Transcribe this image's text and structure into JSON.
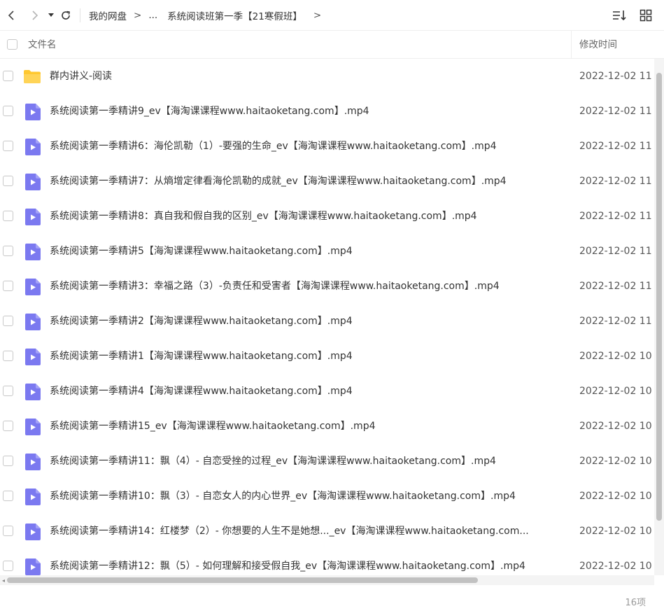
{
  "nav": {
    "breadcrumbs": [
      "我的网盘",
      "...",
      "系统阅读班第一季【21寒假班】"
    ],
    "separator": ">",
    "trailing_separator": ">"
  },
  "columns": {
    "name": "文件名",
    "time": "修改时间"
  },
  "files": [
    {
      "type": "folder",
      "name": "群内讲义-阅读",
      "time": "2022-12-02 11"
    },
    {
      "type": "video",
      "name": "系统阅读第一季精讲9_ev【海淘课课程www.haitaoketang.com】.mp4",
      "time": "2022-12-02 11"
    },
    {
      "type": "video",
      "name": "系统阅读第一季精讲6：海伦凯勒（1）-要强的生命_ev【海淘课课程www.haitaoketang.com】.mp4",
      "time": "2022-12-02 11"
    },
    {
      "type": "video",
      "name": "系统阅读第一季精讲7：从熵增定律看海伦凯勒的成就_ev【海淘课课程www.haitaoketang.com】.mp4",
      "time": "2022-12-02 11"
    },
    {
      "type": "video",
      "name": "系统阅读第一季精讲8：真自我和假自我的区别_ev【海淘课课程www.haitaoketang.com】.mp4",
      "time": "2022-12-02 11"
    },
    {
      "type": "video",
      "name": "系统阅读第一季精讲5【海淘课课程www.haitaoketang.com】.mp4",
      "time": "2022-12-02 11"
    },
    {
      "type": "video",
      "name": "系统阅读第一季精讲3：幸福之路（3）-负责任和受害者【海淘课课程www.haitaoketang.com】.mp4",
      "time": "2022-12-02 11"
    },
    {
      "type": "video",
      "name": "系统阅读第一季精讲2【海淘课课程www.haitaoketang.com】.mp4",
      "time": "2022-12-02 11"
    },
    {
      "type": "video",
      "name": "系统阅读第一季精讲1【海淘课课程www.haitaoketang.com】.mp4",
      "time": "2022-12-02 10"
    },
    {
      "type": "video",
      "name": "系统阅读第一季精讲4【海淘课课程www.haitaoketang.com】.mp4",
      "time": "2022-12-02 10"
    },
    {
      "type": "video",
      "name": "系统阅读第一季精讲15_ev【海淘课课程www.haitaoketang.com】.mp4",
      "time": "2022-12-02 10"
    },
    {
      "type": "video",
      "name": "系统阅读第一季精讲11：飘（4）- 自恋受挫的过程_ev【海淘课课程www.haitaoketang.com】.mp4",
      "time": "2022-12-02 10"
    },
    {
      "type": "video",
      "name": "系统阅读第一季精讲10：飘（3）- 自恋女人的内心世界_ev【海淘课课程www.haitaoketang.com】.mp4",
      "time": "2022-12-02 10"
    },
    {
      "type": "video",
      "name": "系统阅读第一季精讲14：红楼梦（2）- 你想要的人生不是她想..._ev【海淘课课程www.haitaoketang.com...",
      "time": "2022-12-02 10"
    },
    {
      "type": "video",
      "name": "系统阅读第一季精讲12：飘（5）- 如何理解和接受假自我_ev【海淘课课程www.haitaoketang.com】.mp4",
      "time": "2022-12-02 10"
    }
  ],
  "status": {
    "count": "16项"
  },
  "colors": {
    "folder": "#FFC830",
    "video": "#7B79F0",
    "border": "#EEEEEE"
  },
  "icons": {
    "back": "chevron-left-icon",
    "forward": "chevron-right-icon",
    "history": "caret-down-icon",
    "refresh": "refresh-icon",
    "sort": "sort-icon",
    "view": "grid-view-icon",
    "folder": "folder-icon",
    "video": "video-file-icon"
  }
}
